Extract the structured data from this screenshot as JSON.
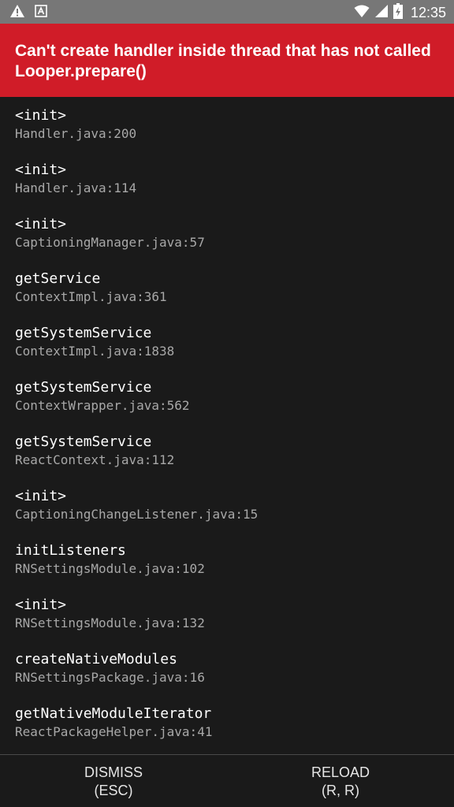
{
  "status_bar": {
    "time": "12:35",
    "left_icons": [
      "warning-icon",
      "font-app-icon"
    ],
    "right_icons": [
      "wifi-icon",
      "signal-icon",
      "battery-charging-icon"
    ]
  },
  "error": {
    "message": "Can't create handler inside thread that has not called Looper.prepare()"
  },
  "stack_frames": [
    {
      "method": "<init>",
      "file": "Handler.java:200"
    },
    {
      "method": "<init>",
      "file": "Handler.java:114"
    },
    {
      "method": "<init>",
      "file": "CaptioningManager.java:57"
    },
    {
      "method": "getService",
      "file": "ContextImpl.java:361"
    },
    {
      "method": "getSystemService",
      "file": "ContextImpl.java:1838"
    },
    {
      "method": "getSystemService",
      "file": "ContextWrapper.java:562"
    },
    {
      "method": "getSystemService",
      "file": "ReactContext.java:112"
    },
    {
      "method": "<init>",
      "file": "CaptioningChangeListener.java:15"
    },
    {
      "method": "initListeners",
      "file": "RNSettingsModule.java:102"
    },
    {
      "method": "<init>",
      "file": "RNSettingsModule.java:132"
    },
    {
      "method": "createNativeModules",
      "file": "RNSettingsPackage.java:16"
    },
    {
      "method": "getNativeModuleIterator",
      "file": "ReactPackageHelper.java:41"
    }
  ],
  "actions": {
    "dismiss_label": "DISMISS",
    "dismiss_shortcut": "(ESC)",
    "reload_label": "RELOAD",
    "reload_shortcut": "(R, R)"
  },
  "colors": {
    "banner": "#d01c28",
    "background": "#1a1a1a",
    "status_bar": "#777777"
  }
}
